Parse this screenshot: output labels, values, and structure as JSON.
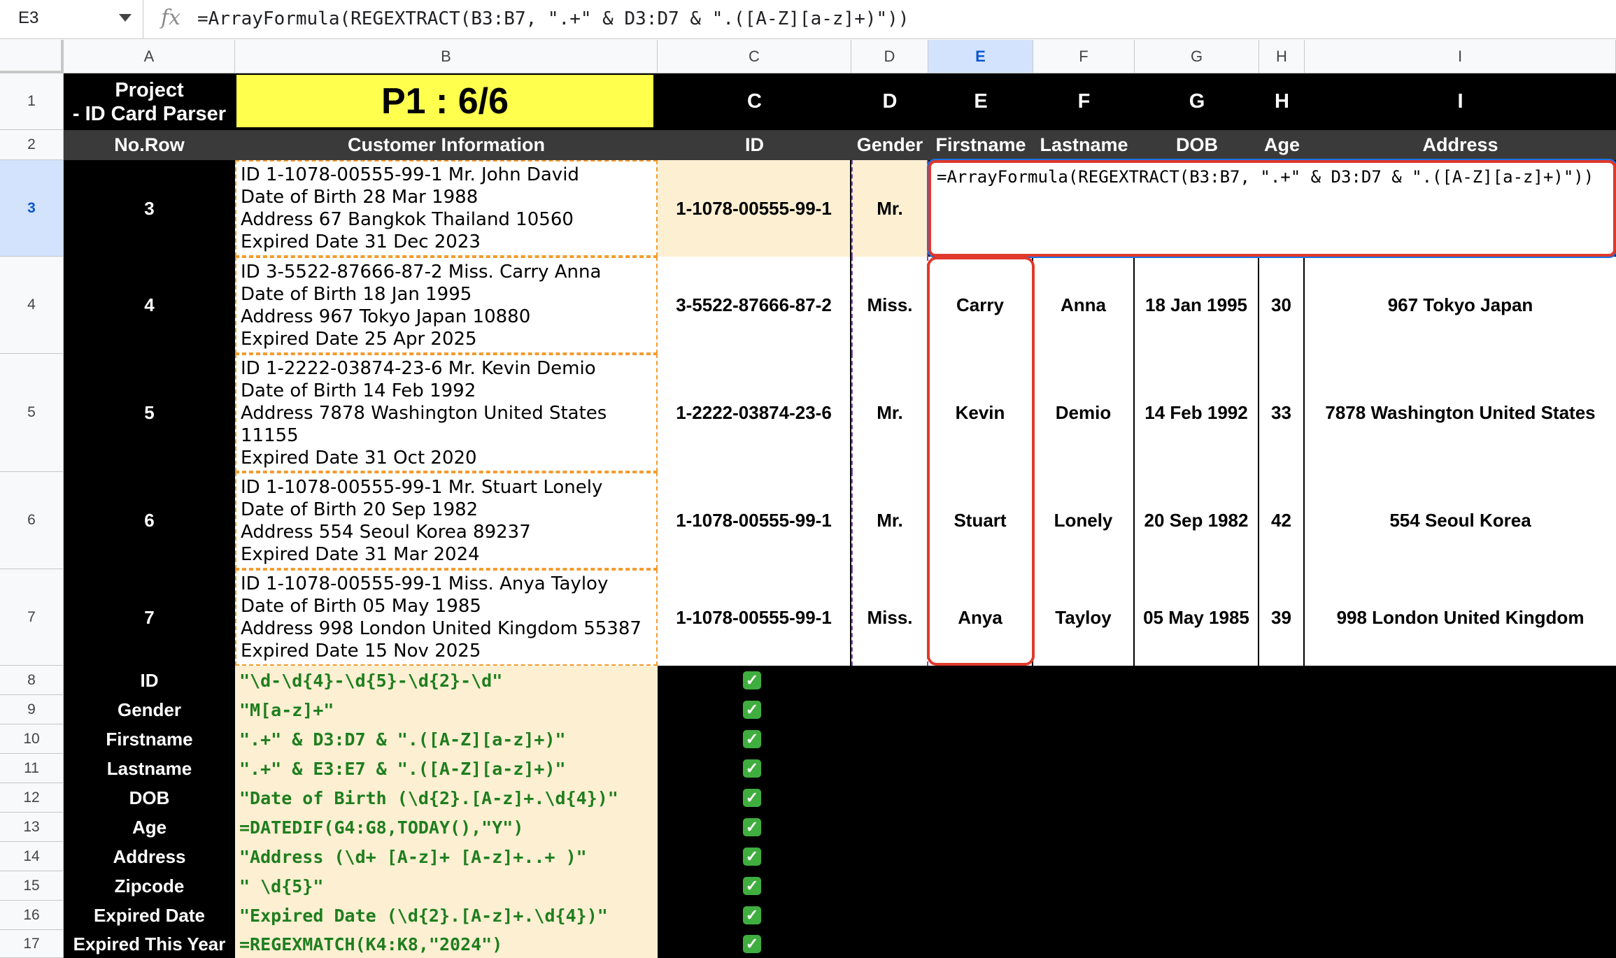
{
  "formula_bar": {
    "cell_ref": "E3",
    "fx": "fx",
    "formula": "=ArrayFormula(REGEXTRACT(B3:B7, \".+\" & D3:D7 & \".([A-Z][a-z]+)\"))"
  },
  "columns": [
    "A",
    "B",
    "C",
    "D",
    "E",
    "F",
    "G",
    "H",
    "I"
  ],
  "rows": [
    "1",
    "2",
    "3",
    "4",
    "5",
    "6",
    "7",
    "8",
    "9",
    "10",
    "11",
    "12",
    "13",
    "14",
    "15",
    "16",
    "17"
  ],
  "row1": {
    "project": [
      "Project",
      "- ID Card Parser"
    ],
    "banner": "P1 : 6/6",
    "C": "C",
    "D": "D",
    "E": "E",
    "F": "F",
    "G": "G",
    "H": "H",
    "I": "I"
  },
  "row2": {
    "A": "No.Row",
    "B": "Customer Information",
    "C": "ID",
    "D": "Gender",
    "E": "Firstname",
    "F": "Lastname",
    "G": "DOB",
    "H": "Age",
    "I": "Address"
  },
  "records": [
    {
      "no": "3",
      "info": [
        "ID 1-1078-00555-99-1 Mr. John David",
        "Date of Birth 28 Mar 1988",
        "Address 67 Bangkok Thailand 10560",
        "Expired Date 31 Dec 2023"
      ],
      "id": "1-1078-00555-99-1",
      "gender": "Mr.",
      "first": "",
      "last": "",
      "dob": "",
      "age": "",
      "address": ""
    },
    {
      "no": "4",
      "info": [
        "ID 3-5522-87666-87-2 Miss. Carry Anna",
        "Date of Birth 18 Jan 1995",
        "Address 967 Tokyo Japan 10880",
        "Expired Date 25 Apr 2025"
      ],
      "id": "3-5522-87666-87-2",
      "gender": "Miss.",
      "first": "Carry",
      "last": "Anna",
      "dob": "18 Jan 1995",
      "age": "30",
      "address": "967 Tokyo Japan"
    },
    {
      "no": "5",
      "info": [
        "ID 1-2222-03874-23-6 Mr. Kevin Demio",
        "Date of Birth 14 Feb 1992",
        "Address 7878 Washington United States",
        "11155",
        "Expired Date 31 Oct 2020"
      ],
      "id": "1-2222-03874-23-6",
      "gender": "Mr.",
      "first": "Kevin",
      "last": "Demio",
      "dob": "14 Feb 1992",
      "age": "33",
      "address": "7878 Washington United States"
    },
    {
      "no": "6",
      "info": [
        "ID 1-1078-00555-99-1 Mr. Stuart Lonely",
        "Date of Birth 20 Sep 1982",
        "Address 554 Seoul Korea 89237",
        "Expired Date 31 Mar 2024"
      ],
      "id": "1-1078-00555-99-1",
      "gender": "Mr.",
      "first": "Stuart",
      "last": "Lonely",
      "dob": "20 Sep 1982",
      "age": "42",
      "address": "554 Seoul Korea"
    },
    {
      "no": "7",
      "info": [
        "ID 1-1078-00555-99-1 Miss. Anya Tayloy",
        "Date of Birth 05 May 1985",
        "Address 998 London United Kingdom 55387",
        "Expired Date 15 Nov 2025"
      ],
      "id": "1-1078-00555-99-1",
      "gender": "Miss.",
      "first": "Anya",
      "last": "Tayloy",
      "dob": "05 May 1985",
      "age": "39",
      "address": "998 London United Kingdom"
    }
  ],
  "patterns": [
    {
      "label": "ID",
      "value": "\"\\d-\\d{4}-\\d{5}-\\d{2}-\\d\""
    },
    {
      "label": "Gender",
      "value": "\"M[a-z]+\""
    },
    {
      "label": "Firstname",
      "value": "\".+\" & D3:D7 & \".([A-Z][a-z]+)\""
    },
    {
      "label": "Lastname",
      "value": "\".+\" & E3:E7 & \".([A-Z][a-z]+)\""
    },
    {
      "label": "DOB",
      "value": "\"Date of Birth (\\d{2}.[A-z]+.\\d{4})\""
    },
    {
      "label": "Age",
      "value": "=DATEDIF(G4:G8,TODAY(),\"Y\")"
    },
    {
      "label": "Address",
      "value": "\"Address (\\d+ [A-z]+ [A-z]+..+ )\""
    },
    {
      "label": "Zipcode",
      "value": "\" \\d{5}\""
    },
    {
      "label": "Expired Date",
      "value": "\"Expired Date (\\d{2}.[A-z]+.\\d{4})\""
    },
    {
      "label": "Expired This Year",
      "value": "=REGEXMATCH(K4:K8,\"2024\")"
    }
  ],
  "check_glyph": "✓",
  "editor": {
    "text": "=ArrayFormula(REGEXTRACT(B3:B7, \".+\" & D3:D7 & \".([A-Z][a-z]+)\"))"
  },
  "colors": {
    "banner": "#ffff4d",
    "cream": "#fcefd2",
    "pattern_green": "#1e7e1e",
    "selection": "#1a73e8",
    "highlight_red": "#e0392b"
  }
}
